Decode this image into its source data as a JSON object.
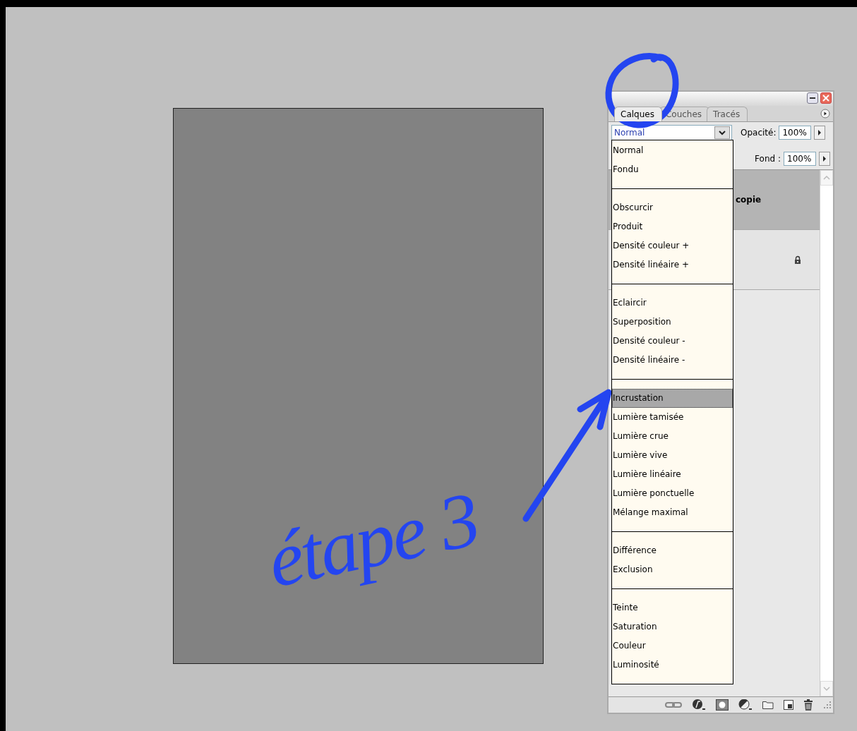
{
  "annotation": {
    "text": "étape 3"
  },
  "panel": {
    "tabs": [
      {
        "label": "Calques",
        "selected": true
      },
      {
        "label": "Couches",
        "selected": false
      },
      {
        "label": "Tracés",
        "selected": false
      }
    ],
    "blend_mode": {
      "value": "Normal"
    },
    "opacity": {
      "label": "Opacité:",
      "value": "100%"
    },
    "fill": {
      "label": "Fond :",
      "value": "100%"
    },
    "layers": [
      {
        "name": "copie",
        "selected": true,
        "locked": false
      },
      {
        "selected": false,
        "locked": true
      }
    ],
    "blend_menu": {
      "groups": [
        {
          "items": [
            {
              "label": "Normal",
              "selected": false
            },
            {
              "label": "Fondu",
              "selected": false
            }
          ]
        },
        {
          "items": [
            {
              "label": "Obscurcir",
              "selected": false
            },
            {
              "label": "Produit",
              "selected": false
            },
            {
              "label": "Densité couleur +",
              "selected": false
            },
            {
              "label": "Densité linéaire +",
              "selected": false
            }
          ]
        },
        {
          "items": [
            {
              "label": "Eclaircir",
              "selected": false
            },
            {
              "label": "Superposition",
              "selected": false
            },
            {
              "label": "Densité couleur -",
              "selected": false
            },
            {
              "label": "Densité linéaire -",
              "selected": false
            }
          ]
        },
        {
          "items": [
            {
              "label": "Incrustation",
              "selected": true
            },
            {
              "label": "Lumière tamisée",
              "selected": false
            },
            {
              "label": "Lumière crue",
              "selected": false
            },
            {
              "label": "Lumière vive",
              "selected": false
            },
            {
              "label": "Lumière linéaire",
              "selected": false
            },
            {
              "label": "Lumière ponctuelle",
              "selected": false
            },
            {
              "label": "Mélange maximal",
              "selected": false
            }
          ]
        },
        {
          "items": [
            {
              "label": "Différence",
              "selected": false
            },
            {
              "label": "Exclusion",
              "selected": false
            }
          ]
        },
        {
          "items": [
            {
              "label": "Teinte",
              "selected": false
            },
            {
              "label": "Saturation",
              "selected": false
            },
            {
              "label": "Couleur",
              "selected": false
            },
            {
              "label": "Luminosité",
              "selected": false
            }
          ]
        }
      ]
    }
  }
}
